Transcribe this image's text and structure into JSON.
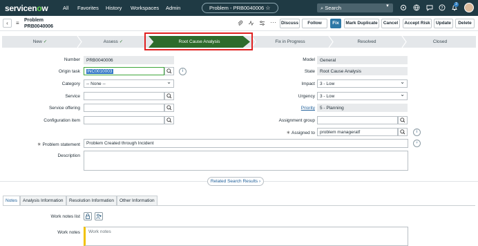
{
  "nav": {
    "brand_pre": "servicen",
    "brand_o": "o",
    "brand_post": "w",
    "links": [
      "All",
      "Favorites",
      "History",
      "Workspaces",
      "Admin"
    ],
    "record_pill": "Problem - PRB0040006",
    "search_placeholder": "Search",
    "notification_count": "3"
  },
  "form_header": {
    "title": "Problem",
    "record_number": "PRB0040006",
    "buttons": [
      "Discuss",
      "Follow",
      "Fix",
      "Mark Duplicate",
      "Cancel",
      "Accept Risk",
      "Update",
      "Delete"
    ]
  },
  "stages": {
    "items": [
      {
        "label": "New",
        "done": "✓"
      },
      {
        "label": "Assess",
        "done": "✓"
      },
      {
        "label": "Root Cause Analysis",
        "done": ""
      },
      {
        "label": "Fix in Progress",
        "done": ""
      },
      {
        "label": "Resolved",
        "done": ""
      },
      {
        "label": "Closed",
        "done": ""
      }
    ],
    "active_index": 2
  },
  "fields": {
    "number": {
      "label": "Number",
      "value": "PRB0040006"
    },
    "origin_task": {
      "label": "Origin task",
      "value": "INC0010003"
    },
    "category": {
      "label": "Category",
      "value": "-- None --"
    },
    "service": {
      "label": "Service",
      "value": ""
    },
    "service_offering": {
      "label": "Service offering",
      "value": ""
    },
    "configuration_item": {
      "label": "Configuration item",
      "value": ""
    },
    "problem_statement": {
      "label": "Problem statement",
      "value": "Problem Created through Incident"
    },
    "description": {
      "label": "Description",
      "value": ""
    },
    "model": {
      "label": "Model",
      "value": "General"
    },
    "state": {
      "label": "State",
      "value": "Root Cause Analysis"
    },
    "impact": {
      "label": "Impact",
      "value": "3 - Low"
    },
    "urgency": {
      "label": "Urgency",
      "value": "3 - Low"
    },
    "priority": {
      "label": "Priority",
      "value": "5 - Planning"
    },
    "assignment_group": {
      "label": "Assignment group",
      "value": ""
    },
    "assigned_to": {
      "label": "Assigned to",
      "value": "problem manageratf"
    }
  },
  "related_search": "Related Search Results",
  "tabs": [
    "Notes",
    "Analysis Information",
    "Resolution Information",
    "Other Information"
  ],
  "notes": {
    "work_notes_list_label": "Work notes list",
    "work_notes_label": "Work notes",
    "work_notes_placeholder": "Work notes"
  },
  "colors": {
    "nav_bg": "#1f3a44",
    "active_stage": "#2e6b2c",
    "highlight_border": "#e02020",
    "primary_button": "#2d78a6"
  }
}
